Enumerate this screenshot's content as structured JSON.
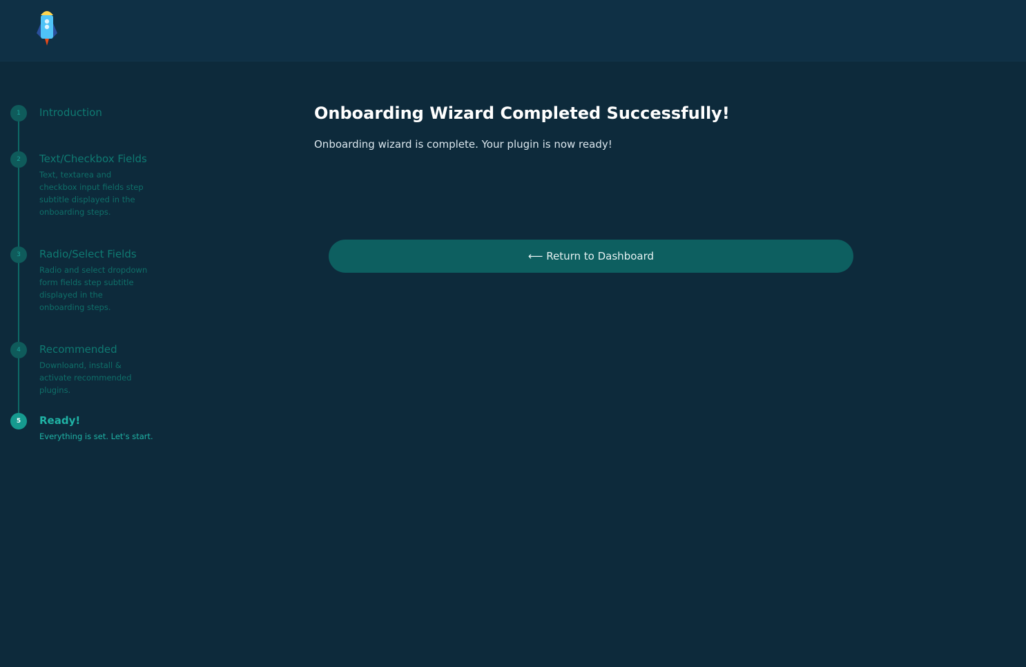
{
  "header": {
    "logo_icon": "rocket-icon"
  },
  "steps": [
    {
      "number": "1",
      "title": "Introduction",
      "subtitle": ""
    },
    {
      "number": "2",
      "title": "Text/Checkbox Fields",
      "subtitle": "Text, textarea and checkbox input fields step subtitle displayed in the onboarding steps."
    },
    {
      "number": "3",
      "title": "Radio/Select Fields",
      "subtitle": "Radio and select dropdown form fields step subtitle displayed in the onboarding steps."
    },
    {
      "number": "4",
      "title": "Recommended",
      "subtitle": "Downloand, install & activate recommended plugins."
    },
    {
      "number": "5",
      "title": "Ready!",
      "subtitle": "Everything is set. Let's start."
    }
  ],
  "content": {
    "title": "Onboarding Wizard Completed Successfully!",
    "text": "Onboarding wizard is complete. Your plugin is now ready!",
    "cta_label": "⟵ Return to Dashboard"
  }
}
